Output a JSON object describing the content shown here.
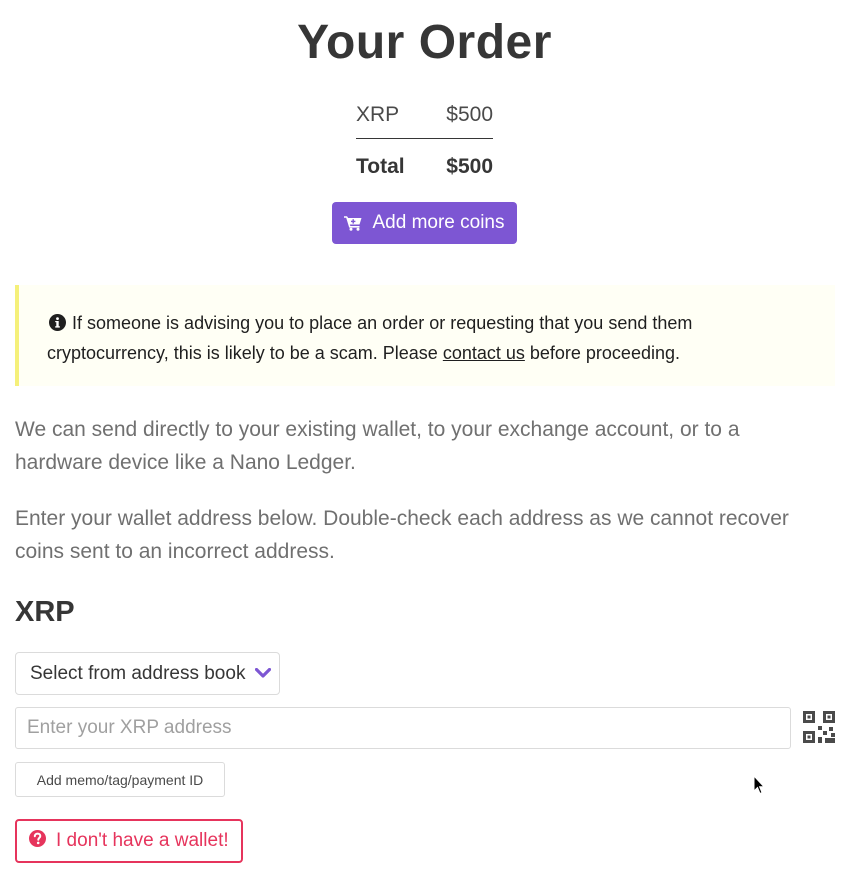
{
  "order": {
    "title": "Your Order",
    "items": [
      {
        "coin": "XRP",
        "amount": "$500"
      }
    ],
    "total_label": "Total",
    "total_value": "$500",
    "add_more_label": "Add more coins"
  },
  "notice": {
    "text_before": "If someone is advising you to place an order or requesting that you send them cryptocurrency, this is likely to be a scam. Please ",
    "link_text": "contact us",
    "text_after": " before proceeding."
  },
  "intro": {
    "paragraph1": "We can send directly to your existing wallet, to your exchange account, or to a hardware device like a Nano Ledger.",
    "paragraph2": "Enter your wallet address below. Double-check each address as we cannot recover coins sent to an incorrect address."
  },
  "wallet": {
    "coin_heading": "XRP",
    "address_book_label": "Select from address book",
    "address_placeholder": "Enter your XRP address",
    "address_value": "",
    "memo_label": "Add memo/tag/payment ID",
    "no_wallet_label": "I don't have a wallet!"
  },
  "icons": {
    "cart": "cart-icon",
    "info": "info-circle-icon",
    "chevron": "chevron-down-icon",
    "qr": "qr-code-icon",
    "question": "question-circle-icon"
  },
  "colors": {
    "accent": "#7d56d3",
    "danger": "#e6345c",
    "notice_border": "#f5f07a",
    "notice_bg": "#fffff5"
  }
}
